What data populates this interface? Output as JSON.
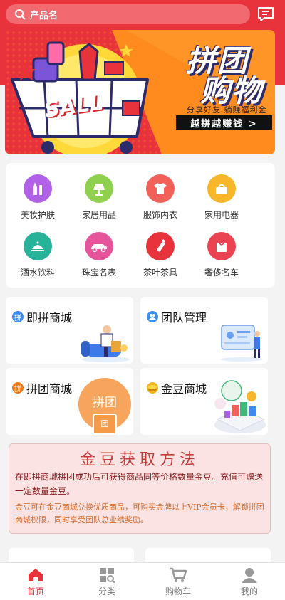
{
  "search": {
    "placeholder": "产品名"
  },
  "banner": {
    "title_line1": "拼团",
    "title_line2": "购物",
    "subtitle": "分享好友  躺赚福利金",
    "cta": "越拼越赚钱 >",
    "sale_text": "SALL"
  },
  "categories": [
    {
      "label": "美妆护肤",
      "icon": "lipstick-icon",
      "color": "#b061e8"
    },
    {
      "label": "家居用品",
      "icon": "lamp-icon",
      "color": "#8fd14f"
    },
    {
      "label": "服饰内衣",
      "icon": "shirt-icon",
      "color": "#f2605a"
    },
    {
      "label": "家用电器",
      "icon": "appliance-icon",
      "color": "#f8b62a"
    },
    {
      "label": "酒水饮料",
      "icon": "dish-icon",
      "color": "#27b39a"
    },
    {
      "label": "珠宝名表",
      "icon": "car-icon",
      "color": "#e6559c"
    },
    {
      "label": "茶叶茶具",
      "icon": "bottle-icon",
      "color": "#e8323c"
    },
    {
      "label": "奢侈名车",
      "icon": "bag-icon",
      "color": "#ea4452"
    }
  ],
  "modules": {
    "instant_mall": {
      "label": "即拼商城",
      "badge": "拼"
    },
    "team_manage": {
      "label": "团队管理"
    },
    "group_mall": {
      "label": "拼团商城",
      "badge": "拼",
      "illus_text": "拼团",
      "bag_text": "团"
    },
    "gold_mall": {
      "label": "金豆商城"
    }
  },
  "gold_info": {
    "title": "金豆获取方法",
    "para1": "在即拼商城拼团成功后可获得商品同等价格数量金豆。充值可赠送一定数量金豆。",
    "para2": "金豆可在金豆商城兑换优质商品，可购买金牌以上VIP会员卡，解锁拼团商城权限，同时享受团队总业绩奖励。"
  },
  "tabbar": [
    {
      "label": "首页",
      "icon": "home-icon",
      "active": true
    },
    {
      "label": "分类",
      "icon": "category-icon",
      "active": false
    },
    {
      "label": "购物车",
      "icon": "cart-icon",
      "active": false
    },
    {
      "label": "我的",
      "icon": "user-icon",
      "active": false
    }
  ],
  "colors": {
    "brand": "#e8323c",
    "gold_title": "#c63a3a"
  }
}
